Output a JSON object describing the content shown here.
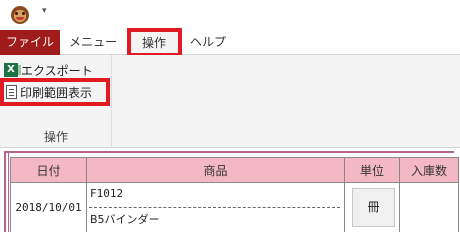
{
  "qat": {
    "dropdown_glyph": "▾"
  },
  "tabs": {
    "file": "ファイル",
    "menu": "メニュー",
    "ops": "操作",
    "help": "ヘルプ"
  },
  "ribbon": {
    "export_label": "エクスポート",
    "print_label": "印刷範囲表示",
    "group_label": "操作"
  },
  "table": {
    "headers": {
      "date": "日付",
      "product": "商品",
      "unit": "単位",
      "qty": "入庫数"
    },
    "rows": [
      {
        "date": "2018/10/01",
        "code": "F1012",
        "name": "B5バインダー",
        "unit": "冊",
        "qty": ""
      }
    ]
  },
  "colors": {
    "accent": "#a01c1c",
    "highlight": "#e01b24",
    "header_bg": "#f4b8c4"
  }
}
